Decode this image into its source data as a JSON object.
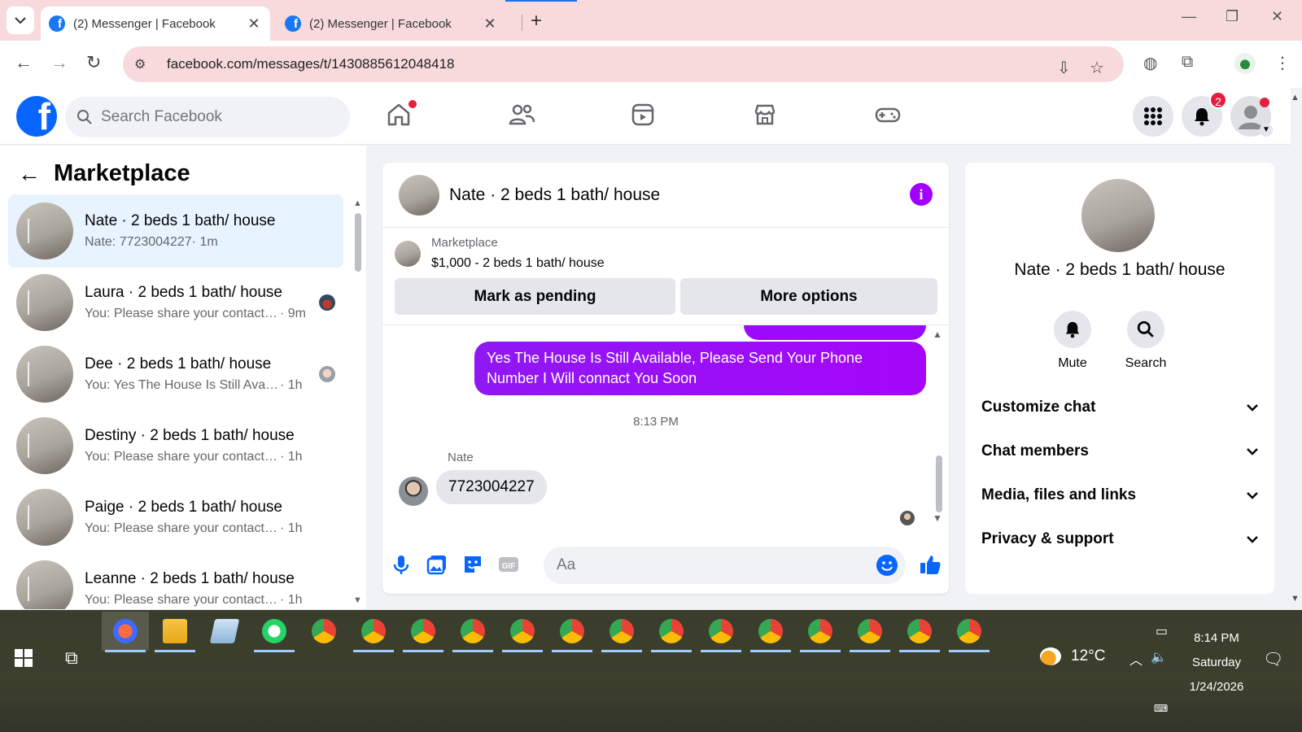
{
  "browser": {
    "tabs": [
      {
        "title": "(2) Messenger | Facebook",
        "close": "✕"
      },
      {
        "title": "(2) Messenger | Facebook",
        "close": "✕"
      }
    ],
    "new_tab": "+",
    "url": "facebook.com/messages/t/1430885612048418"
  },
  "fb": {
    "logo": "f",
    "search_placeholder": "Search Facebook",
    "notifications_count": "2"
  },
  "left": {
    "title": "Marketplace",
    "conversations": [
      {
        "name": "Nate · 2 beds 1 bath/ house",
        "preview": "Nate: 7723004227",
        "time": " · 1m"
      },
      {
        "name": "Laura · 2 beds 1 bath/ house",
        "preview": "You: Please share your contact number",
        "time": " · 9m"
      },
      {
        "name": "Dee · 2 beds 1 bath/ house",
        "preview": "You: Yes The House Is Still Available",
        "time": " · 1h"
      },
      {
        "name": "Destiny · 2 beds 1 bath/ house",
        "preview": "You: Please share your contact number",
        "time": " · 1h"
      },
      {
        "name": "Paige · 2 beds 1 bath/ house",
        "preview": "You: Please share your contact number",
        "time": " · 1h"
      },
      {
        "name": "Leanne · 2 beds 1 bath/ house",
        "preview": "You: Please share your contact number",
        "time": " · 1h"
      }
    ]
  },
  "chat": {
    "title": "Nate · 2 beds 1 bath/ house",
    "marketplace_label": "Marketplace",
    "listing": "$1,000 - 2 beds 1 bath/ house",
    "mark_pending": "Mark as pending",
    "more_options": "More options",
    "outgoing_message": "Yes The House Is Still Available, Please Send Your Phone Number I Will connact You Soon",
    "timestamp": "8:13 PM",
    "sender": "Nate",
    "incoming_message": "7723004227",
    "composer_placeholder": "Aa"
  },
  "right": {
    "name": "Nate · 2 beds 1 bath/ house",
    "mute": "Mute",
    "search": "Search",
    "sections": [
      "Customize chat",
      "Chat members",
      "Media, files and links",
      "Privacy & support"
    ]
  },
  "taskbar": {
    "temperature": "12°C",
    "time": "8:14 PM",
    "day": "Saturday",
    "date": "1/24/2026"
  }
}
